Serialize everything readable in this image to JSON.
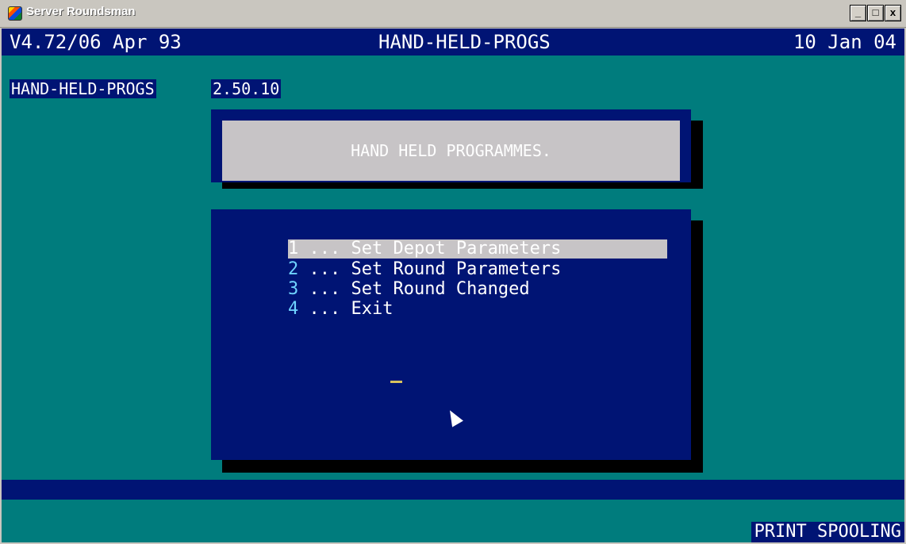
{
  "window": {
    "title": "Server Roundsman",
    "buttons": {
      "minimize": "_",
      "maximize": "□",
      "close": "x"
    }
  },
  "top_bar": {
    "version": "V4.72/06 Apr 93",
    "center_title": "HAND-HELD-PROGS",
    "date": "10 Jan 04"
  },
  "program": {
    "name": "HAND-HELD-PROGS",
    "version": "2.50.10"
  },
  "panel": {
    "title": "HAND HELD PROGRAMMES."
  },
  "menu": {
    "items": [
      {
        "num": "1",
        "label": " ... Set Depot Parameters"
      },
      {
        "num": "2",
        "label": " ... Set Round Parameters"
      },
      {
        "num": "3",
        "label": " ... Set Round Changed"
      },
      {
        "num": "4",
        "label": " ... Exit"
      }
    ]
  },
  "status": {
    "print_spooling": "PRINT SPOOLING"
  },
  "colors": {
    "teal": "#007c7d",
    "navy": "#001474",
    "highlight": "#c7c4c6",
    "number_cyan": "#6fd3ff"
  }
}
